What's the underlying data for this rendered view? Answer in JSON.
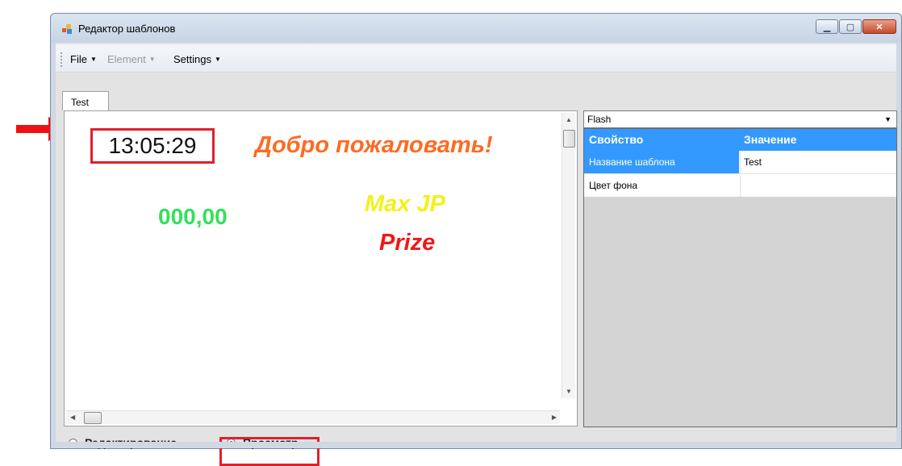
{
  "window": {
    "title": "Редактор шаблонов"
  },
  "menu": {
    "file": "File",
    "element": "Element",
    "settings": "Settings"
  },
  "tab": {
    "label": "Test"
  },
  "canvas": {
    "time": "13:05:29",
    "welcome": "Добро пожаловать!",
    "amount": "000,00",
    "max_jp": "Max JP",
    "prize": "Prize"
  },
  "properties": {
    "dropdown_value": "Flash",
    "header": {
      "property": "Свойство",
      "value": "Значение"
    },
    "rows": [
      {
        "property": "Название шаблона",
        "value": "Test"
      },
      {
        "property": "Цвет фона",
        "value": ""
      }
    ]
  },
  "mode": {
    "edit": "Редактирование",
    "view": "Просмотр",
    "selected": "view"
  },
  "colors": {
    "clock_border": "#e0202a",
    "welcome": "#ff6a21",
    "amount": "#33e05a",
    "max_jp": "#f4f01a",
    "prize": "#f01818",
    "selection": "#3399ff"
  }
}
